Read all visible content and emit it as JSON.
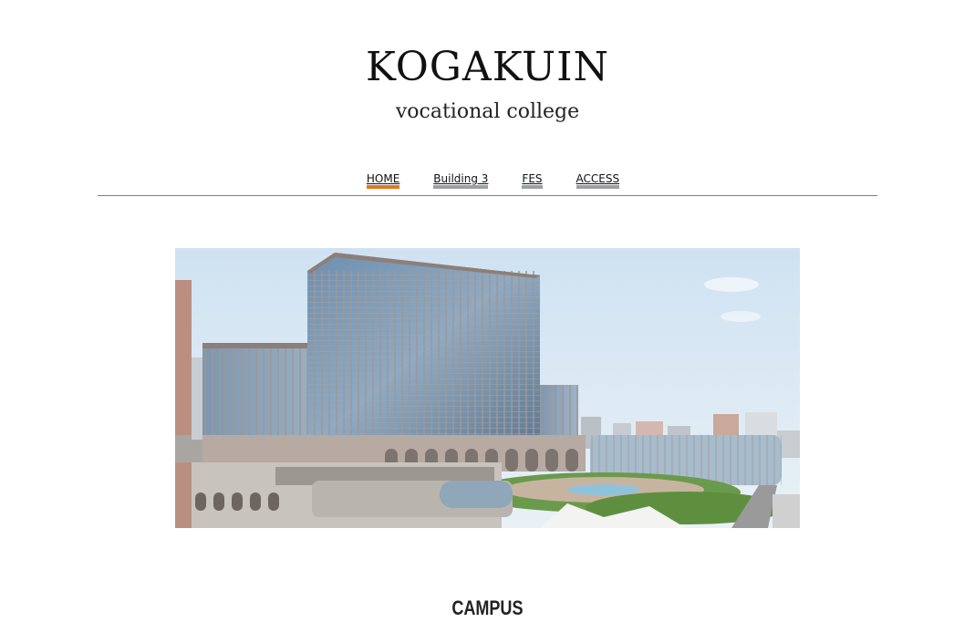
{
  "header": {
    "title": "KOGAKUIN",
    "subtitle": "vocational college"
  },
  "nav": {
    "items": [
      {
        "label": "HOME",
        "active": true
      },
      {
        "label": "Building 3",
        "active": false
      },
      {
        "label": "FES",
        "active": false
      },
      {
        "label": "ACCESS",
        "active": false
      }
    ],
    "active_color": "#e07a1f",
    "inactive_color": "#9aa0a8"
  },
  "hero": {
    "image": "campus-building-photo"
  },
  "main": {
    "section_title": "CAMPUS"
  }
}
